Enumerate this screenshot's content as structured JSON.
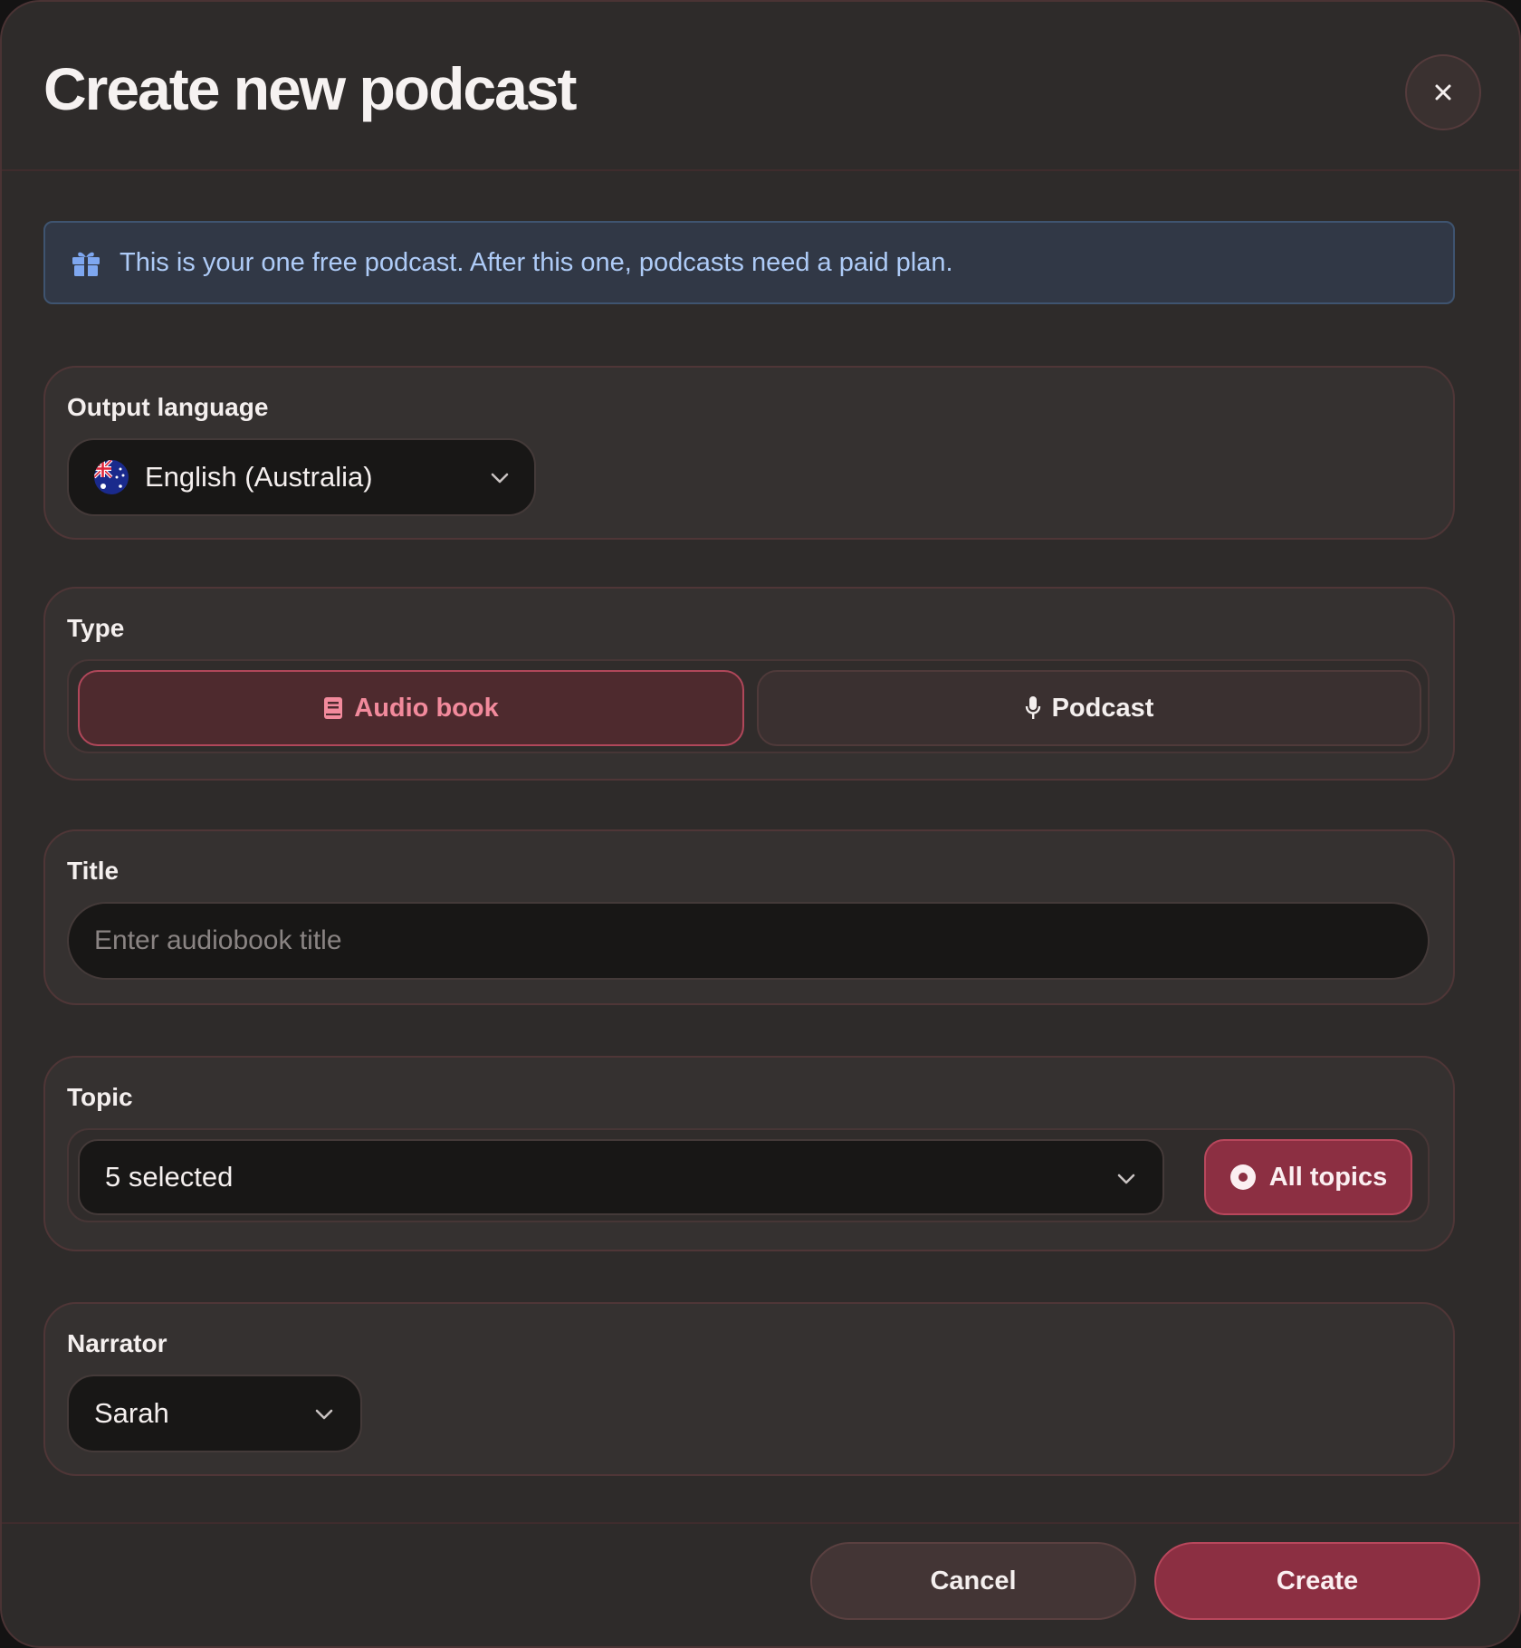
{
  "dialog": {
    "title": "Create new podcast",
    "close_icon": "close-icon"
  },
  "banner": {
    "icon": "gift-icon",
    "text": "This is your one free podcast. After this one, podcasts need a paid plan."
  },
  "output_language": {
    "label": "Output language",
    "flag_icon": "australia-flag-icon",
    "value": "English (Australia)"
  },
  "type": {
    "label": "Type",
    "options": [
      {
        "label": "Audio book",
        "icon": "book-icon",
        "selected": true
      },
      {
        "label": "Podcast",
        "icon": "microphone-icon",
        "selected": false
      }
    ]
  },
  "title_field": {
    "label": "Title",
    "placeholder": "Enter audiobook title",
    "value": ""
  },
  "topic": {
    "label": "Topic",
    "value": "5 selected",
    "all_topics_label": "All topics"
  },
  "narrator": {
    "label": "Narrator",
    "value": "Sarah"
  },
  "footer": {
    "cancel_label": "Cancel",
    "create_label": "Create"
  },
  "colors": {
    "accent": "#8c2f42",
    "accent_text": "#f28a9c",
    "banner_text": "#aecbf7",
    "background": "#2e2b2a"
  }
}
